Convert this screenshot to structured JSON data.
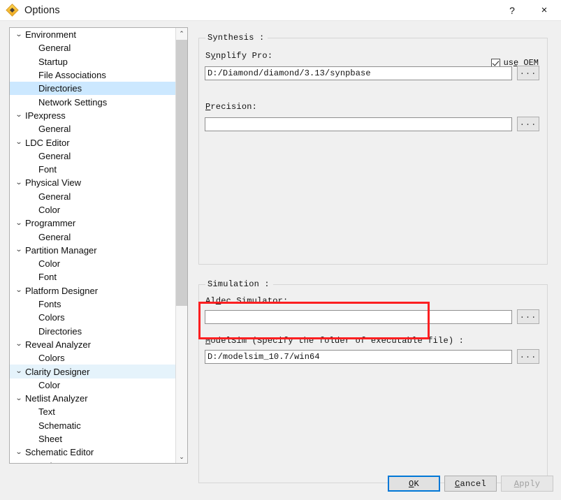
{
  "window": {
    "title": "Options",
    "icon": "diamond-app-icon",
    "help_label": "?",
    "close_label": "×"
  },
  "sidebar": {
    "items": [
      {
        "label": "Environment",
        "level": "parent",
        "chevron": "⌄",
        "state": "normal"
      },
      {
        "label": "General",
        "level": "child",
        "chevron": "",
        "state": "normal"
      },
      {
        "label": "Startup",
        "level": "child",
        "chevron": "",
        "state": "normal"
      },
      {
        "label": "File Associations",
        "level": "child",
        "chevron": "",
        "state": "normal"
      },
      {
        "label": "Directories",
        "level": "child",
        "chevron": "",
        "state": "selected"
      },
      {
        "label": "Network Settings",
        "level": "child",
        "chevron": "",
        "state": "normal"
      },
      {
        "label": "IPexpress",
        "level": "parent",
        "chevron": "⌄",
        "state": "normal"
      },
      {
        "label": "General",
        "level": "child",
        "chevron": "",
        "state": "normal"
      },
      {
        "label": "LDC Editor",
        "level": "parent",
        "chevron": "⌄",
        "state": "normal"
      },
      {
        "label": "General",
        "level": "child",
        "chevron": "",
        "state": "normal"
      },
      {
        "label": "Font",
        "level": "child",
        "chevron": "",
        "state": "normal"
      },
      {
        "label": "Physical View",
        "level": "parent",
        "chevron": "⌄",
        "state": "normal"
      },
      {
        "label": "General",
        "level": "child",
        "chevron": "",
        "state": "normal"
      },
      {
        "label": "Color",
        "level": "child",
        "chevron": "",
        "state": "normal"
      },
      {
        "label": "Programmer",
        "level": "parent",
        "chevron": "⌄",
        "state": "normal"
      },
      {
        "label": "General",
        "level": "child",
        "chevron": "",
        "state": "normal"
      },
      {
        "label": "Partition Manager",
        "level": "parent",
        "chevron": "⌄",
        "state": "normal"
      },
      {
        "label": "Color",
        "level": "child",
        "chevron": "",
        "state": "normal"
      },
      {
        "label": "Font",
        "level": "child",
        "chevron": "",
        "state": "normal"
      },
      {
        "label": "Platform Designer",
        "level": "parent",
        "chevron": "⌄",
        "state": "normal"
      },
      {
        "label": "Fonts",
        "level": "child",
        "chevron": "",
        "state": "normal"
      },
      {
        "label": "Colors",
        "level": "child",
        "chevron": "",
        "state": "normal"
      },
      {
        "label": "Directories",
        "level": "child",
        "chevron": "",
        "state": "normal"
      },
      {
        "label": "Reveal Analyzer",
        "level": "parent",
        "chevron": "⌄",
        "state": "normal"
      },
      {
        "label": "Colors",
        "level": "child",
        "chevron": "",
        "state": "normal"
      },
      {
        "label": "Clarity Designer",
        "level": "parent",
        "chevron": "⌄",
        "state": "hover"
      },
      {
        "label": "Color",
        "level": "child",
        "chevron": "",
        "state": "normal"
      },
      {
        "label": "Netlist Analyzer",
        "level": "parent",
        "chevron": "⌄",
        "state": "normal"
      },
      {
        "label": "Text",
        "level": "child",
        "chevron": "",
        "state": "normal"
      },
      {
        "label": "Schematic",
        "level": "child",
        "chevron": "",
        "state": "normal"
      },
      {
        "label": "Sheet",
        "level": "child",
        "chevron": "",
        "state": "normal"
      },
      {
        "label": "Schematic Editor",
        "level": "parent",
        "chevron": "⌄",
        "state": "normal"
      },
      {
        "label": "Colors",
        "level": "child",
        "chevron": "",
        "state": "normal"
      }
    ],
    "scrollbar": {
      "up_arrow": "⌃",
      "down_arrow": "⌄"
    }
  },
  "synthesis": {
    "group_title": "Synthesis :",
    "synplify": {
      "label_pre": "S",
      "label_mnemonic": "y",
      "label_post": "nplify Pro:",
      "value": "D:/Diamond/diamond/3.13/synpbase",
      "browse_label": "..."
    },
    "precision": {
      "label_pre": "",
      "label_mnemonic": "P",
      "label_post": "recision:",
      "value": "",
      "browse_label": "..."
    },
    "oem": {
      "label_pre": "us",
      "label_mnemonic": "e",
      "label_post": " OEM",
      "checked": true
    }
  },
  "simulation": {
    "group_title": "Simulation :",
    "aldec": {
      "label_pre": "Al",
      "label_mnemonic": "d",
      "label_post": "ec Simulator:",
      "value": "",
      "browse_label": "..."
    },
    "modelsim": {
      "label_pre": "",
      "label_mnemonic": "M",
      "label_post": "odelSim (Specify the folder of executable file) :",
      "value": "D:/modelsim_10.7/win64",
      "browse_label": "..."
    }
  },
  "annotation": {
    "color": "#fc1f21"
  },
  "footer": {
    "ok": {
      "pre": "",
      "mnemonic": "O",
      "post": "K"
    },
    "cancel": {
      "pre": "",
      "mnemonic": "C",
      "post": "ancel"
    },
    "apply": {
      "pre": "",
      "mnemonic": "A",
      "post": "pply",
      "disabled": true
    }
  },
  "theme": {
    "selection_blue": "#cce8ff",
    "hover_blue": "#e5f3fb",
    "focus_blue": "#0078d7",
    "annotation_red": "#fc1f21"
  }
}
